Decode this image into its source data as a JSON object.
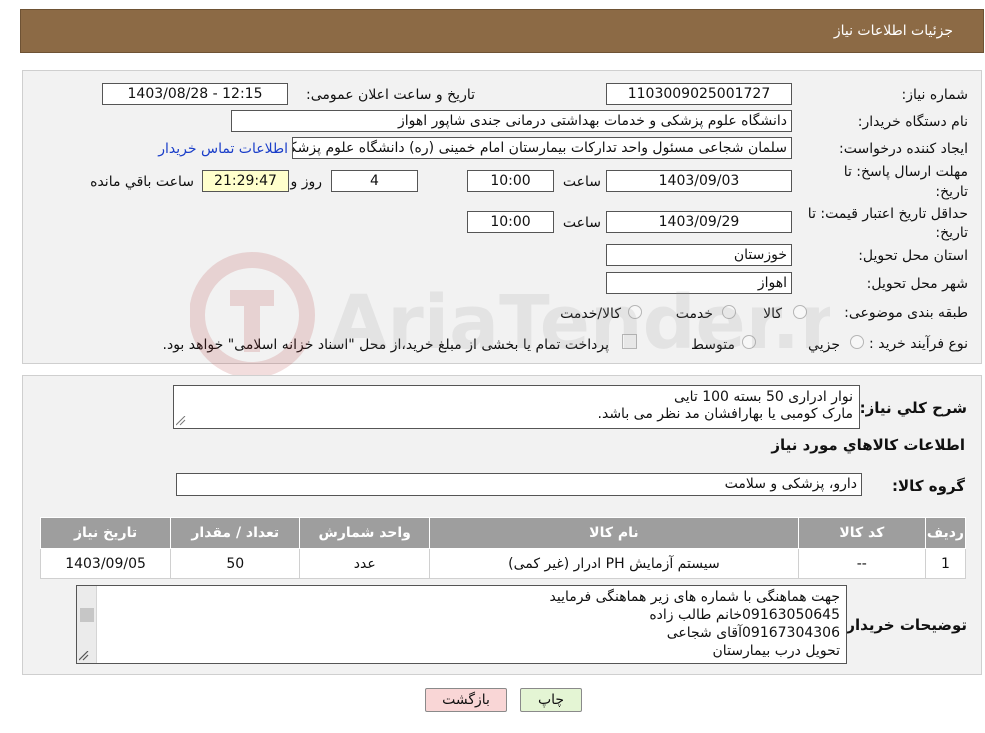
{
  "header": {
    "title": "جزئیات اطلاعات نیاز"
  },
  "form": {
    "need_number_label": "شماره نیاز:",
    "need_number": "1103009025001727",
    "announce_datetime_label": "تاریخ و ساعت اعلان عمومی:",
    "announce_datetime": "1403/08/28 - 12:15",
    "buyer_org_label": "نام دستگاه خریدار:",
    "buyer_org": "دانشگاه علوم پزشکی و خدمات بهداشتی درمانی جندی شاپور اهواز",
    "requester_label": "ایجاد کننده درخواست:",
    "requester": "سلمان شجاعی مسئول واحد تدارکات بیمارستان امام خمینی (ره) دانشگاه علوم پزشکی",
    "buyer_contact_link": "اطلاعات تماس خریدار",
    "reply_deadline_label_1": "مهلت ارسال پاسخ: تا",
    "reply_deadline_label_2": "تاریخ:",
    "reply_deadline_date": "1403/09/03",
    "time_label": "ساعت",
    "reply_deadline_time": "10:00",
    "days_remaining": "4",
    "days_label": "روز و",
    "countdown": "21:29:47",
    "remaining_label": "ساعت باقي مانده",
    "price_validity_label_1": "حداقل تاریخ اعتبار قیمت: تا",
    "price_validity_label_2": "تاریخ:",
    "price_validity_date": "1403/09/29",
    "price_validity_time": "10:00",
    "province_label": "استان محل تحویل:",
    "province": "خوزستان",
    "city_label": "شهر محل تحویل:",
    "city": "اهواز",
    "category_label": "طبقه بندی موضوعی:",
    "category_options": [
      "کالا",
      "خدمت",
      "کالا/خدمت"
    ],
    "process_label": "نوع فرآیند خرید :",
    "process_options": [
      "جزيي",
      "متوسط"
    ],
    "treasury_note": "پرداخت تمام یا بخشی از مبلغ خرید،از محل \"اسناد خزانه اسلامی\" خواهد بود."
  },
  "details": {
    "description_label": "شرح کلي نياز:",
    "description_lines": [
      "نوار ادراری 50 بسته 100 تایی",
      "مارک کومبی یا بهارافشان مد نظر می باشد."
    ],
    "goods_info_title": "اطلاعات کالاهاي مورد نياز",
    "goods_group_label": "گروه کالا:",
    "goods_group": "دارو، پزشکی و سلامت",
    "table": {
      "headers": [
        "ردیف",
        "کد کالا",
        "نام کالا",
        "واحد شمارش",
        "تعداد / مقدار",
        "تاریخ نیاز"
      ],
      "rows": [
        [
          "1",
          "--",
          "سیستم آزمایش PH ادرار (غیر کمی)",
          "عدد",
          "50",
          "1403/09/05"
        ]
      ]
    },
    "buyer_notes_label": "توضیحات خریدار:",
    "buyer_notes_lines": [
      "جهت هماهنگی با شماره های زیر هماهنگی فرمایید",
      "09163050645خانم طالب زاده",
      "09167304306آقای شجاعی",
      "تحویل درب بیمارستان"
    ]
  },
  "buttons": {
    "print": "چاپ",
    "back": "بازگشت"
  },
  "colors": {
    "header": "#8c6a45",
    "panel": "#f2f2f2",
    "table_header": "#9e9e9e",
    "print_bg": "#e4f5d4",
    "back_bg": "#f9d6d6"
  },
  "watermark": "AriaTender.neT"
}
